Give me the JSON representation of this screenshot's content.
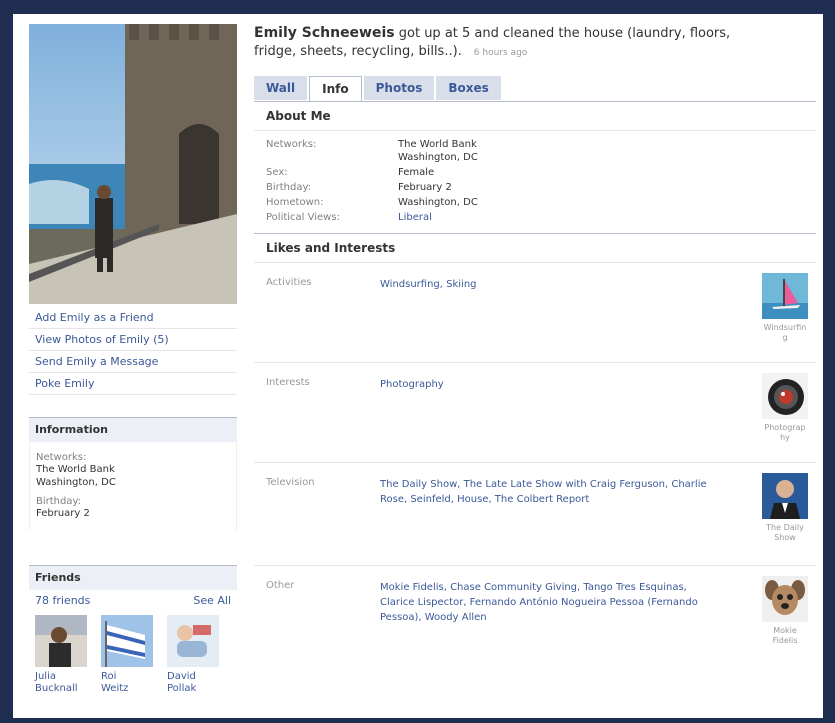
{
  "status": {
    "name": "Emily Schneeweis",
    "text": " got up at 5 and cleaned the house (laundry, floors, fridge, sheets, recycling, bills..).",
    "time": "6 hours ago"
  },
  "tabs": [
    {
      "label": "Wall",
      "active": false
    },
    {
      "label": "Info",
      "active": true
    },
    {
      "label": "Photos",
      "active": false
    },
    {
      "label": "Boxes",
      "active": false
    }
  ],
  "left_actions": [
    "Add Emily as a Friend",
    "View Photos of Emily (5)",
    "Send Emily a Message",
    "Poke Emily"
  ],
  "information_box": {
    "title": "Information",
    "networks_label": "Networks:",
    "networks_line1": "The World Bank",
    "networks_line2": "Washington, DC",
    "birthday_label": "Birthday:",
    "birthday_value": "February 2"
  },
  "friends_box": {
    "title": "Friends",
    "count": "78 friends",
    "see_all": "See All",
    "friends": [
      {
        "first": "Julia",
        "last": "Bucknall"
      },
      {
        "first": "Roi",
        "last": "Weitz"
      },
      {
        "first": "David",
        "last": "Pollak"
      }
    ]
  },
  "about_me": {
    "title": "About Me",
    "rows": [
      {
        "label": "Networks:",
        "value": "The World Bank",
        "value2": "Washington, DC",
        "link": false
      },
      {
        "label": "Sex:",
        "value": "Female",
        "link": false
      },
      {
        "label": "Birthday:",
        "value": "February 2",
        "link": false
      },
      {
        "label": "Hometown:",
        "value": "Washington, DC",
        "link": false
      },
      {
        "label": "Political Views:",
        "value": "Liberal",
        "link": true
      }
    ]
  },
  "likes": {
    "title": "Likes and Interests",
    "blocks": [
      {
        "label": "Activities",
        "values": "Windsurfing, Skiing",
        "thumb_caption": "Windsurfin g",
        "thumb_icon": "windsurfing-photo"
      },
      {
        "label": "Interests",
        "values": "Photography",
        "thumb_caption": "Photograp hy",
        "thumb_icon": "camera-lens-photo"
      },
      {
        "label": "Television",
        "values": "The Daily Show, The Late Late Show with Craig Ferguson, Charlie Rose, Seinfeld, House, The Colbert Report",
        "thumb_caption": "The Daily Show",
        "thumb_icon": "tv-host-photo"
      },
      {
        "label": "Other",
        "values": "Mokie Fidelis, Chase Community Giving, Tango Tres Esquinas, Clarice Lispector, Fernando António Nogueira Pessoa (Fernando Pessoa), Woody Allen",
        "thumb_caption": "Mokie Fidelis",
        "thumb_icon": "puppy-photo"
      }
    ]
  },
  "colors": {
    "link": "#3b5998",
    "frame_border": "#1f2d50",
    "tab_bg": "#d8dfea",
    "box_header_bg": "#eceff5"
  }
}
